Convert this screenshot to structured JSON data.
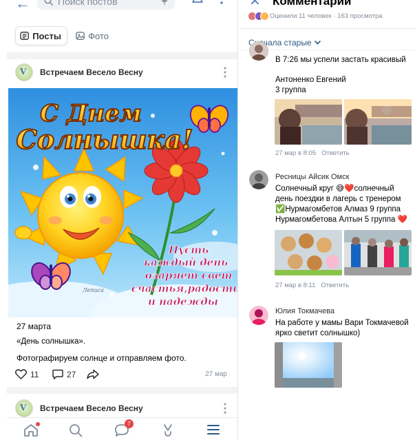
{
  "left": {
    "search": {
      "placeholder": "Поиск постов"
    },
    "tabs": [
      {
        "label": "Посты",
        "icon": "posts-icon",
        "active": true
      },
      {
        "label": "Фото",
        "icon": "photo-icon",
        "active": false
      }
    ],
    "group_name": "Встречаем Весело Весну",
    "post": {
      "image_text_title_1": "С Днем",
      "image_text_title_2": "Солнышка!",
      "image_text_wish_1": "Пусть",
      "image_text_wish_2": "каждый день",
      "image_text_wish_3": "озаряет свет",
      "image_text_wish_4": "счастья,радости",
      "image_text_wish_5": "и надежды",
      "image_signature": "Леписа",
      "date": "27 марта",
      "quote": "«День солнышка».",
      "text": "Фотографируем солнце и отправляем фото.",
      "likes": "11",
      "comments": "27",
      "time": "27 мар"
    },
    "second_post": {
      "group_name": "Встречаем Весело Весну"
    },
    "nav": {
      "items": [
        "home-icon",
        "search-icon",
        "messages-icon",
        "clips-icon",
        "menu-icon"
      ],
      "messages_badge": "7"
    }
  },
  "right": {
    "title": "Комментарии",
    "stats": "Оценили 11 человек · 163 просмотра",
    "sort_label": "Сначала старые",
    "comments": [
      {
        "text": "В 7:26 мы успели застать красивый"
      },
      {
        "name": "Антоненко Евгений",
        "line": "3 группа",
        "meta_time": "27 мар в 8:05",
        "reply": "Ответить"
      },
      {
        "name": "Ресницы Айсик Омск",
        "lines": [
          "Солнечный круг 😅❤️солнечный",
          "день поездки в лагерь с тренером",
          "✅Нурмагомбетов Алмаз 9 группа",
          "Нурмагомбетова Алтын 5 группа ❤️"
        ],
        "meta_time": "27 мар в 8:11",
        "reply": "Ответить"
      },
      {
        "name": "Юлия Токмачева",
        "lines": [
          "На работе у мамы Вари Токмачевой",
          "ярко светит солнышко)"
        ]
      }
    ]
  },
  "colors": {
    "accent": "#2a5885",
    "link_blue": "#5181b8",
    "badge_red": "#e64646",
    "meta_gray": "#818c99"
  }
}
